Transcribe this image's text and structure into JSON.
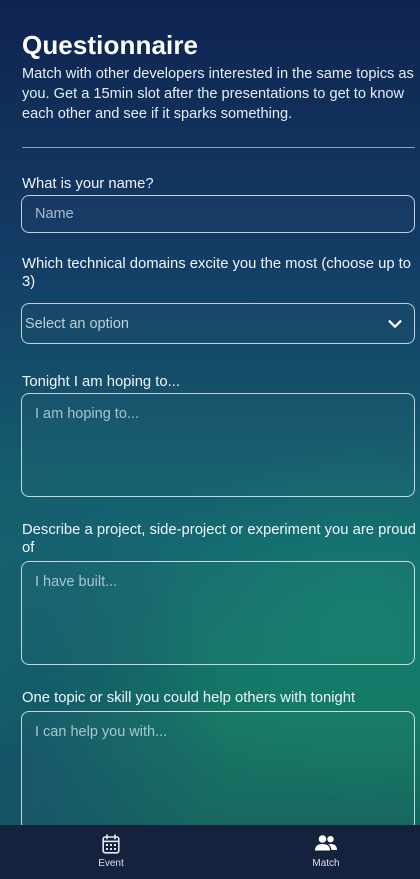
{
  "header": {
    "title": "Questionnaire",
    "intro": "Match with other developers interested in the same topics as you. Get a 15min slot after the presentations to get to know each other and see if it sparks something."
  },
  "form": {
    "name": {
      "label": "What is your name?",
      "placeholder": "Name",
      "value": ""
    },
    "domains": {
      "label": "Which technical domains excite you the most (choose up to 3)",
      "selected": "Select an option"
    },
    "hoping": {
      "label": "Tonight I am hoping to...",
      "placeholder": "I am hoping to...",
      "value": ""
    },
    "project": {
      "label": "Describe a project, side-project or experiment you are proud of",
      "placeholder": "I have built...",
      "value": ""
    },
    "help": {
      "label": "One topic or skill you could help others with tonight",
      "placeholder": "I can help you with...",
      "value": ""
    }
  },
  "tabbar": {
    "tabs": [
      {
        "label": "Event",
        "icon": "calendar-icon",
        "active": false
      },
      {
        "label": "Match",
        "icon": "people-icon",
        "active": true
      }
    ]
  },
  "colors": {
    "background_top": "#0f2350",
    "background_bottom": "#147563",
    "tabbar": "#15223e",
    "field_border": "#ffffff"
  }
}
